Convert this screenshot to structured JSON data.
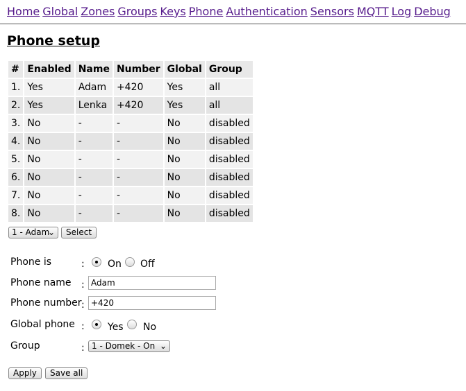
{
  "nav": [
    "Home",
    "Global",
    "Zones",
    "Groups",
    "Keys",
    "Phone",
    "Authentication",
    "Sensors",
    "MQTT",
    "Log",
    "Debug"
  ],
  "title": "Phone setup",
  "table": {
    "headers": [
      "#",
      "Enabled",
      "Name",
      "Number",
      "Global",
      "Group"
    ],
    "rows": [
      [
        "1.",
        "Yes",
        "Adam",
        "+420",
        "Yes",
        "all"
      ],
      [
        "2.",
        "Yes",
        "Lenka",
        "+420",
        "Yes",
        "all"
      ],
      [
        "3.",
        "No",
        "-",
        "-",
        "No",
        "disabled"
      ],
      [
        "4.",
        "No",
        "-",
        "-",
        "No",
        "disabled"
      ],
      [
        "5.",
        "No",
        "-",
        "-",
        "No",
        "disabled"
      ],
      [
        "6.",
        "No",
        "-",
        "-",
        "No",
        "disabled"
      ],
      [
        "7.",
        "No",
        "-",
        "-",
        "No",
        "disabled"
      ],
      [
        "8.",
        "No",
        "-",
        "-",
        "No",
        "disabled"
      ]
    ]
  },
  "phone_select": {
    "value": "1 - Adam",
    "button": "Select"
  },
  "form": {
    "phone_is": {
      "label": "Phone is",
      "on": "On",
      "off": "Off",
      "selected": "On"
    },
    "phone_name": {
      "label": "Phone name",
      "value": "Adam"
    },
    "phone_number": {
      "label": "Phone number",
      "value": "+420"
    },
    "global_phone": {
      "label": "Global phone",
      "yes": "Yes",
      "no": "No",
      "selected": "Yes"
    },
    "group": {
      "label": "Group",
      "value": "1 - Domek - On"
    },
    "colon": ":"
  },
  "buttons": {
    "apply": "Apply",
    "save_all": "Save all"
  }
}
